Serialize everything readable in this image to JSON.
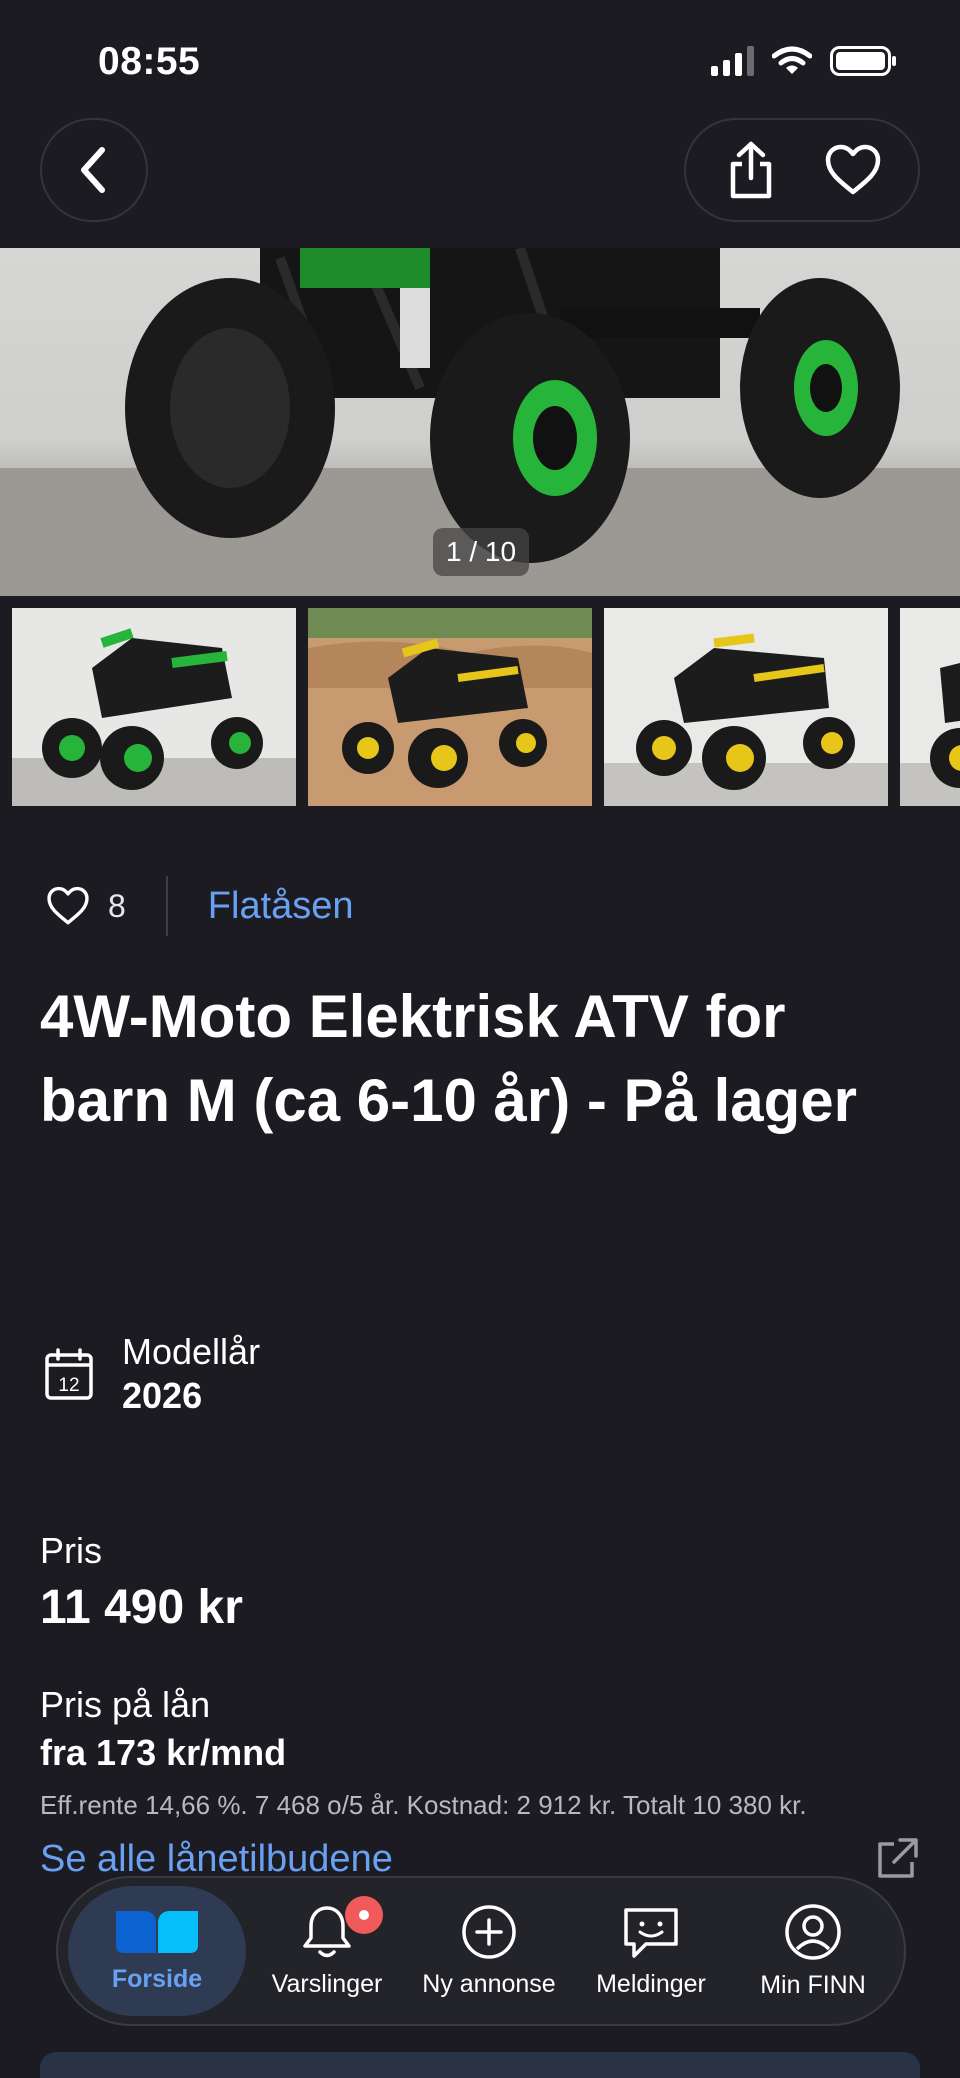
{
  "status_bar": {
    "time": "08:55"
  },
  "gallery": {
    "counter": "1 / 10"
  },
  "listing": {
    "favorites_count": "8",
    "location": "Flatåsen",
    "title": "4W-Moto Elektrisk ATV for barn M (ca 6-10 år) - På lager",
    "model_year_label": "Modellår",
    "model_year_value": "2026",
    "calendar_day": "12",
    "price_label": "Pris",
    "price_value": "11 490 kr",
    "loan_label": "Pris på lån",
    "loan_value": "fra 173 kr/mnd",
    "loan_details": "Eff.rente 14,66 %. 7 468 o/5 år. Kostnad: 2 912 kr. Totalt 10 380 kr.",
    "loan_link": "Se alle lånetilbudene"
  },
  "tab_bar": {
    "items": [
      {
        "label": "Forside",
        "icon": "finn-logo-icon",
        "active": true
      },
      {
        "label": "Varslinger",
        "icon": "bell-icon",
        "badge": true
      },
      {
        "label": "Ny annonse",
        "icon": "plus-circle-icon"
      },
      {
        "label": "Meldinger",
        "icon": "chat-icon"
      },
      {
        "label": "Min FINN",
        "icon": "profile-icon"
      }
    ]
  },
  "colors": {
    "background": "#1b1b21",
    "link": "#6aa0f2",
    "active_tab": "#2e3b52",
    "badge": "#f05a5a",
    "atv_green": "#27b43a",
    "atv_yellow": "#e6c619"
  }
}
